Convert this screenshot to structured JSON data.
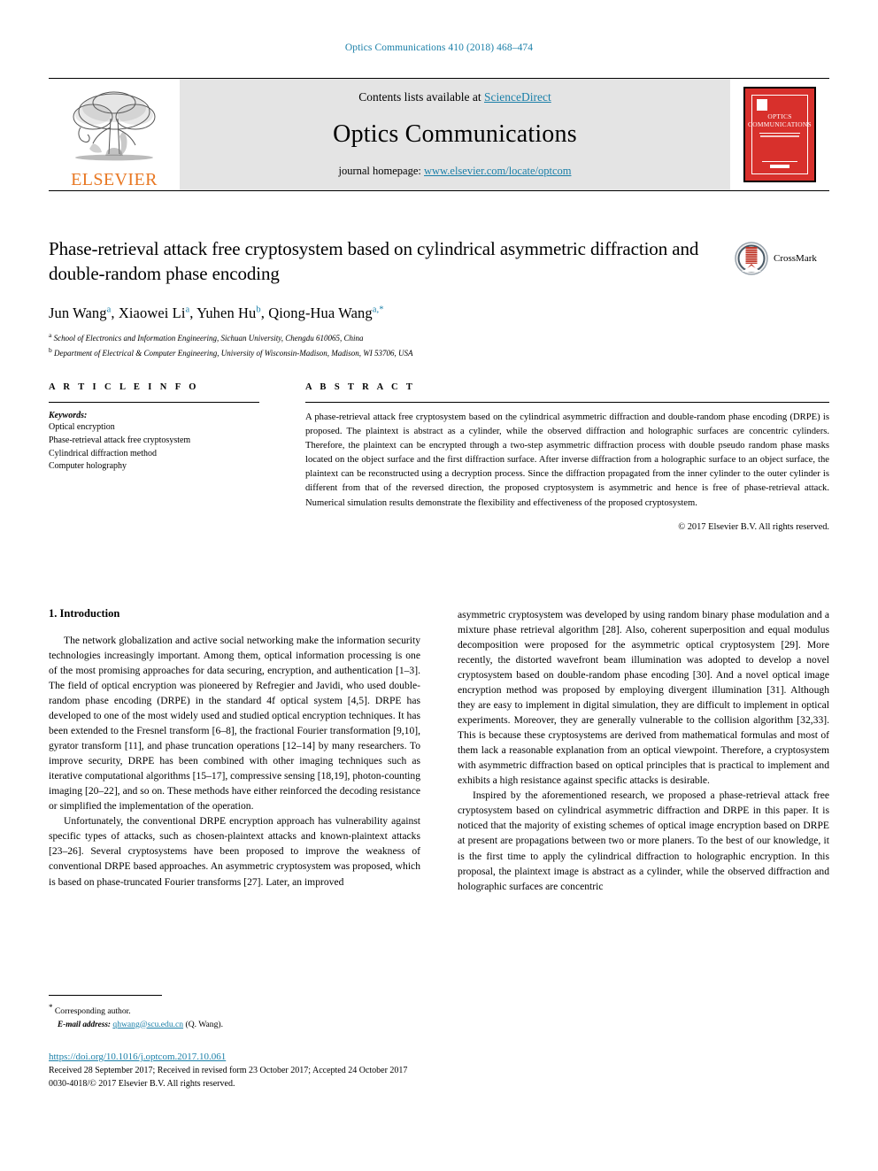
{
  "running_head": "Optics Communications 410 (2018) 468–474",
  "masthead": {
    "publisher_logo_text": "ELSEVIER",
    "contents_prefix": "Contents lists available at ",
    "contents_link": "ScienceDirect",
    "journal_name": "Optics Communications",
    "homepage_prefix": "journal homepage: ",
    "homepage_url": "www.elsevier.com/locate/optcom",
    "cover": {
      "line1": "OPTICS",
      "line2": "COMMUNICATIONS"
    }
  },
  "article": {
    "title": "Phase-retrieval attack free cryptosystem based on cylindrical asymmetric diffraction and double-random phase encoding",
    "crossmark_label": "CrossMark",
    "authors_html": "Jun Wang<sup>a</sup>, Xiaowei Li<sup>a</sup>, Yuhen Hu<sup>b</sup>, Qiong-Hua Wang<sup>a,</sup><sup>*</sup>",
    "affiliations": [
      {
        "marker": "a",
        "text": "School of Electronics and Information Engineering, Sichuan University, Chengdu 610065, China"
      },
      {
        "marker": "b",
        "text": "Department of Electrical & Computer Engineering, University of Wisconsin-Madison, Madison, WI 53706, USA"
      }
    ]
  },
  "article_info": {
    "heading": "A R T I C L E   I N F O",
    "keywords_label": "Keywords:",
    "keywords": [
      "Optical encryption",
      "Phase-retrieval attack free cryptosystem",
      "Cylindrical diffraction method",
      "Computer holography"
    ]
  },
  "abstract": {
    "heading": "A B S T R A C T",
    "text": "A phase-retrieval attack free cryptosystem based on the cylindrical asymmetric diffraction and double-random phase encoding (DRPE) is proposed. The plaintext is abstract as a cylinder, while the observed diffraction and holographic surfaces are concentric cylinders. Therefore, the plaintext can be encrypted through a two-step asymmetric diffraction process with double pseudo random phase masks located on the object surface and the first diffraction surface. After inverse diffraction from a holographic surface to an object surface, the plaintext can be reconstructed using a decryption process. Since the diffraction propagated from the inner cylinder to the outer cylinder is different from that of the reversed direction, the proposed cryptosystem is asymmetric and hence is free of phase-retrieval attack. Numerical simulation results demonstrate the flexibility and effectiveness of the proposed cryptosystem.",
    "copyright": "© 2017 Elsevier B.V. All rights reserved."
  },
  "body": {
    "section_number_title": "1. Introduction",
    "left_paragraphs": [
      "The network globalization and active social networking make the information security technologies increasingly important. Among them, optical information processing is one of the most promising approaches for data securing, encryption, and authentication [1–3]. The field of optical encryption was pioneered by Refregier and Javidi, who used double-random phase encoding (DRPE) in the standard 4f optical system [4,5]. DRPE has developed to one of the most widely used and studied optical encryption techniques. It has been extended to the Fresnel transform [6–8], the fractional Fourier transformation [9,10], gyrator transform [11], and phase truncation operations [12–14] by many researchers. To improve security, DRPE has been combined with other imaging techniques such as iterative computational algorithms [15–17], compressive sensing [18,19], photon-counting imaging [20–22], and so on. These methods have either reinforced the decoding resistance or simplified the implementation of the operation.",
      "Unfortunately, the conventional DRPE encryption approach has vulnerability against specific types of attacks, such as chosen-plaintext attacks and known-plaintext attacks [23–26]. Several cryptosystems have been proposed to improve the weakness of conventional DRPE based approaches. An asymmetric cryptosystem was proposed, which is based on phase-truncated Fourier transforms [27]. Later, an improved"
    ],
    "right_paragraphs": [
      "asymmetric cryptosystem was developed by using random binary phase modulation and a mixture phase retrieval algorithm [28]. Also, coherent superposition and equal modulus decomposition were proposed for the asymmetric optical cryptosystem [29]. More recently, the distorted wavefront beam illumination was adopted to develop a novel cryptosystem based on double-random phase encoding [30]. And a novel optical image encryption method was proposed by employing divergent illumination [31]. Although they are easy to implement in digital simulation, they are difficult to implement in optical experiments. Moreover, they are generally vulnerable to the collision algorithm [32,33]. This is because these cryptosystems are derived from mathematical formulas and most of them lack a reasonable explanation from an optical viewpoint. Therefore, a cryptosystem with asymmetric diffraction based on optical principles that is practical to implement and exhibits a high resistance against specific attacks is desirable.",
      "Inspired by the aforementioned research, we proposed a phase-retrieval attack free cryptosystem based on cylindrical asymmetric diffraction and DRPE in this paper. It is noticed that the majority of existing schemes of optical image encryption based on DRPE at present are propagations between two or more planers. To the best of our knowledge, it is the first time to apply the cylindrical diffraction to holographic encryption. In this proposal, the plaintext image is abstract as a cylinder, while the observed diffraction and holographic surfaces are concentric"
    ]
  },
  "footer": {
    "corresponding_marker": "*",
    "corresponding_text": "Corresponding author.",
    "email_label": "E-mail address:",
    "email": "qhwang@scu.edu.cn",
    "email_suffix": "(Q. Wang).",
    "doi": "https://doi.org/10.1016/j.optcom.2017.10.061",
    "dates": "Received 28 September 2017; Received in revised form 23 October 2017; Accepted 24 October 2017",
    "issn_line": "0030-4018/© 2017 Elsevier B.V. All rights reserved."
  },
  "colors": {
    "link": "#1a7fa8",
    "elsevier_orange": "#E87722",
    "cover_red": "#d8302c",
    "masthead_gray": "#e4e4e4"
  }
}
